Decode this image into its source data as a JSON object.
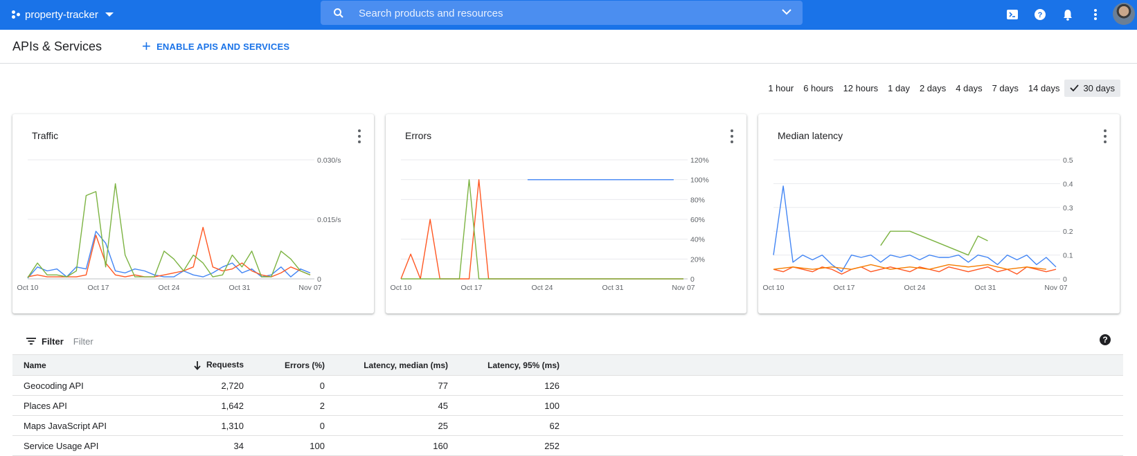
{
  "topbar": {
    "project_name": "property-tracker",
    "search_placeholder": "Search products and resources",
    "icons": [
      "cloud-shell-icon",
      "help-icon",
      "notifications-icon",
      "more-vert-icon",
      "account-avatar"
    ]
  },
  "page": {
    "title": "APIs & Services",
    "enable_button": "ENABLE APIS AND SERVICES"
  },
  "time_ranges": {
    "options": [
      "1 hour",
      "6 hours",
      "12 hours",
      "1 day",
      "2 days",
      "4 days",
      "7 days",
      "14 days",
      "30 days"
    ],
    "selected": "30 days"
  },
  "colors": {
    "brand_blue": "#1a73e8",
    "series_blue": "#4285f4",
    "series_orange": "#ff5722",
    "series_green": "#7cb342",
    "series_amber": "#f57c00"
  },
  "chart_data": [
    {
      "type": "line",
      "title": "Traffic",
      "x_ticks": [
        "Oct 10",
        "Oct 17",
        "Oct 24",
        "Oct 31",
        "Nov 07"
      ],
      "y_ticks": [
        "0",
        "0.015/s",
        "0.030/s"
      ],
      "ylim": [
        0,
        0.03
      ],
      "series": [
        {
          "color": "#4285f4",
          "x": [
            0,
            1,
            2,
            3,
            4,
            5,
            6,
            7,
            8,
            9,
            10,
            11,
            12,
            13,
            14,
            15,
            16,
            17,
            18,
            19,
            20,
            21,
            22,
            23,
            24,
            25,
            26,
            27,
            28,
            29
          ],
          "values": [
            0.0002,
            0.003,
            0.002,
            0.0025,
            0.0005,
            0.003,
            0.0025,
            0.012,
            0.009,
            0.002,
            0.0015,
            0.0025,
            0.002,
            0.001,
            0.0005,
            0.0005,
            0.002,
            0.001,
            0.0005,
            0.0015,
            0.003,
            0.004,
            0.0015,
            0.0025,
            0.0005,
            0.001,
            0.003,
            0.0005,
            0.0025,
            0.0015
          ]
        },
        {
          "color": "#ff5722",
          "x": [
            0,
            1,
            2,
            3,
            4,
            5,
            6,
            7,
            8,
            9,
            10,
            11,
            12,
            13,
            14,
            15,
            16,
            17,
            18,
            19,
            20,
            21,
            22,
            23,
            24,
            25,
            26,
            27,
            28,
            29
          ],
          "values": [
            0.0005,
            0.001,
            0.0005,
            0.0005,
            0.0005,
            0.0005,
            0.001,
            0.011,
            0.004,
            0.001,
            0.0005,
            0.001,
            0.0005,
            0.0005,
            0.001,
            0.0015,
            0.002,
            0.003,
            0.013,
            0.003,
            0.002,
            0.0025,
            0.004,
            0.002,
            0.001,
            0.0005,
            0.0015,
            0.003,
            0.002,
            0.001
          ]
        },
        {
          "color": "#7cb342",
          "x": [
            0,
            1,
            2,
            3,
            4,
            5,
            6,
            7,
            8,
            9,
            10,
            11,
            12,
            13,
            14,
            15,
            16,
            17,
            18,
            19,
            20,
            21,
            22,
            23,
            24,
            25,
            26,
            27,
            28,
            29
          ],
          "values": [
            0.0003,
            0.004,
            0.001,
            0.001,
            0.0005,
            0.002,
            0.021,
            0.022,
            0.003,
            0.024,
            0.006,
            0.0005,
            0.0005,
            0.0005,
            0.007,
            0.005,
            0.002,
            0.006,
            0.004,
            0.0005,
            0.001,
            0.006,
            0.003,
            0.007,
            0.0005,
            0.0005,
            0.007,
            0.005,
            0.002,
            0.001
          ]
        }
      ]
    },
    {
      "type": "line",
      "title": "Errors",
      "x_ticks": [
        "Oct 10",
        "Oct 17",
        "Oct 24",
        "Oct 31",
        "Nov 07"
      ],
      "y_ticks": [
        "0",
        "20%",
        "40%",
        "60%",
        "80%",
        "100%",
        "120%"
      ],
      "ylim": [
        0,
        120
      ],
      "series": [
        {
          "color": "#ff5722",
          "x": [
            0,
            1,
            2,
            3,
            4,
            5,
            6,
            7,
            8,
            9,
            10,
            11,
            12,
            13,
            14,
            15,
            16,
            17,
            18,
            19,
            20,
            21,
            22,
            23,
            24,
            25,
            26,
            27,
            28,
            29
          ],
          "values": [
            0,
            25,
            0,
            60,
            0,
            0,
            0,
            0,
            100,
            0,
            0,
            0,
            0,
            0,
            0,
            0,
            0,
            0,
            0,
            0,
            0,
            0,
            0,
            0,
            0,
            0,
            0,
            0,
            0,
            0
          ]
        },
        {
          "color": "#7cb342",
          "x": [
            0,
            1,
            2,
            3,
            4,
            5,
            6,
            7,
            8,
            9,
            10,
            11,
            12,
            13,
            14,
            15,
            16,
            17,
            18,
            19,
            20,
            21,
            22,
            23,
            24,
            25,
            26,
            27,
            28,
            29
          ],
          "values": [
            0,
            0,
            0,
            0,
            0,
            0,
            0,
            100,
            0,
            0,
            0,
            0,
            0,
            0,
            0,
            0,
            0,
            0,
            0,
            0,
            0,
            0,
            0,
            0,
            0,
            0,
            0,
            0,
            0,
            0
          ]
        },
        {
          "color": "#4285f4",
          "x": [
            13,
            14,
            15,
            17,
            18,
            20,
            22,
            25,
            28
          ],
          "values": [
            100,
            100,
            100,
            100,
            100,
            100,
            100,
            100,
            100
          ]
        }
      ]
    },
    {
      "type": "line",
      "title": "Median latency",
      "x_ticks": [
        "Oct 10",
        "Oct 17",
        "Oct 24",
        "Oct 31",
        "Nov 07"
      ],
      "y_ticks": [
        "0",
        "0.1",
        "0.2",
        "0.3",
        "0.4",
        "0.5"
      ],
      "ylim": [
        0,
        0.5
      ],
      "series": [
        {
          "color": "#4285f4",
          "x": [
            0,
            1,
            2,
            3,
            4,
            5,
            6,
            7,
            8,
            9,
            10,
            11,
            12,
            13,
            14,
            15,
            16,
            17,
            18,
            19,
            20,
            21,
            22,
            23,
            24,
            25,
            26,
            27,
            28,
            29
          ],
          "values": [
            0.1,
            0.39,
            0.07,
            0.1,
            0.08,
            0.1,
            0.06,
            0.03,
            0.1,
            0.09,
            0.1,
            0.07,
            0.1,
            0.09,
            0.1,
            0.08,
            0.1,
            0.09,
            0.09,
            0.1,
            0.07,
            0.1,
            0.09,
            0.06,
            0.1,
            0.08,
            0.1,
            0.06,
            0.09,
            0.05
          ]
        },
        {
          "color": "#7cb342",
          "x": [
            11,
            12,
            13,
            14,
            20,
            21,
            22
          ],
          "values": [
            0.14,
            0.2,
            0.2,
            0.2,
            0.1,
            0.18,
            0.16
          ]
        },
        {
          "color": "#ff5722",
          "x": [
            0,
            1,
            2,
            3,
            4,
            5,
            6,
            7,
            8,
            9,
            10,
            11,
            12,
            13,
            14,
            15,
            16,
            17,
            18,
            19,
            20,
            21,
            22,
            23,
            24,
            25,
            26,
            27,
            28,
            29
          ],
          "values": [
            0.04,
            0.03,
            0.05,
            0.04,
            0.03,
            0.05,
            0.04,
            0.02,
            0.04,
            0.05,
            0.03,
            0.04,
            0.05,
            0.04,
            0.03,
            0.05,
            0.04,
            0.03,
            0.05,
            0.04,
            0.03,
            0.04,
            0.05,
            0.03,
            0.04,
            0.02,
            0.05,
            0.04,
            0.03,
            0.04
          ]
        },
        {
          "color": "#f57c00",
          "x": [
            0,
            2,
            4,
            6,
            8,
            10,
            12,
            14,
            16,
            18,
            20,
            22,
            24,
            26,
            28
          ],
          "values": [
            0.04,
            0.05,
            0.04,
            0.05,
            0.04,
            0.06,
            0.04,
            0.05,
            0.04,
            0.06,
            0.05,
            0.06,
            0.04,
            0.05,
            0.04
          ]
        }
      ]
    }
  ],
  "filter": {
    "label": "Filter",
    "placeholder": "Filter"
  },
  "table": {
    "columns": [
      "Name",
      "Requests",
      "Errors (%)",
      "Latency, median (ms)",
      "Latency, 95% (ms)"
    ],
    "sort_column": "Requests",
    "rows": [
      {
        "name": "Geocoding API",
        "requests": "2,720",
        "errors": "0",
        "latency_median": "77",
        "latency_95": "126"
      },
      {
        "name": "Places API",
        "requests": "1,642",
        "errors": "2",
        "latency_median": "45",
        "latency_95": "100"
      },
      {
        "name": "Maps JavaScript API",
        "requests": "1,310",
        "errors": "0",
        "latency_median": "25",
        "latency_95": "62"
      },
      {
        "name": "Service Usage API",
        "requests": "34",
        "errors": "100",
        "latency_median": "160",
        "latency_95": "252"
      }
    ]
  }
}
